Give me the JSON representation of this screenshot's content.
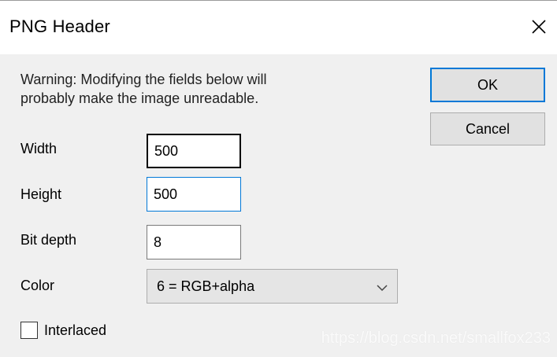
{
  "window": {
    "title": "PNG Header",
    "close_icon": "close-icon"
  },
  "warning": {
    "text": "Warning: Modifying the fields below will\nprobably make the image unreadable."
  },
  "fields": {
    "width": {
      "label": "Width",
      "value": "500"
    },
    "height": {
      "label": "Height",
      "value": "500"
    },
    "bit_depth": {
      "label": "Bit depth",
      "value": "8"
    },
    "color": {
      "label": "Color",
      "selected": "6 = RGB+alpha"
    }
  },
  "options": {
    "interlaced_label": "Interlaced",
    "interlaced_checked": false
  },
  "buttons": {
    "ok": "OK",
    "cancel": "Cancel"
  },
  "watermark": "https://blog.csdn.net/smallfox233",
  "colors": {
    "accent": "#0078d7",
    "dialog_bg": "#f0f0f0",
    "titlebar_bg": "#ffffff"
  }
}
